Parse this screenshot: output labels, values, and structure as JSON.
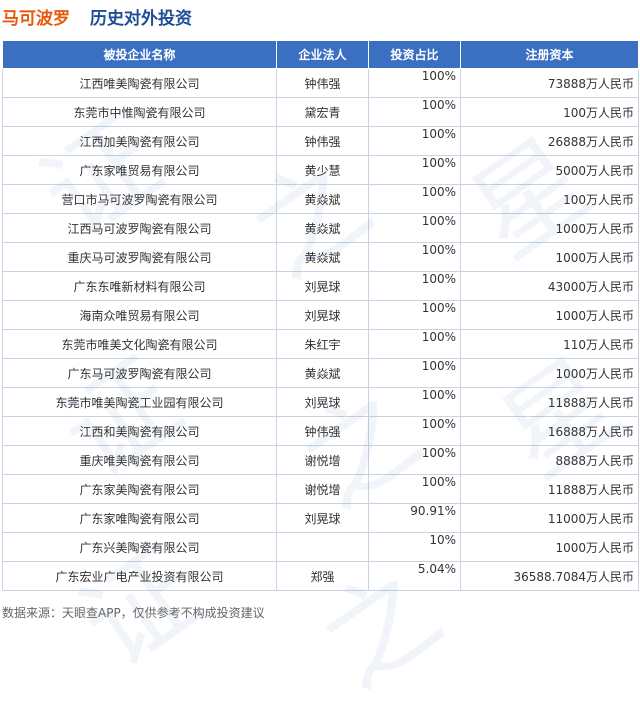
{
  "header": {
    "company": "马可波罗",
    "section": "历史对外投资"
  },
  "table": {
    "columns": [
      "被投企业名称",
      "企业法人",
      "投资占比",
      "注册资本"
    ],
    "rows": [
      {
        "name": "江西唯美陶瓷有限公司",
        "rep": "钟伟强",
        "ratio": "100%",
        "capital": "73888万人民币"
      },
      {
        "name": "东莞市中惟陶瓷有限公司",
        "rep": "黛宏青",
        "ratio": "100%",
        "capital": "100万人民币"
      },
      {
        "name": "江西加美陶瓷有限公司",
        "rep": "钟伟强",
        "ratio": "100%",
        "capital": "26888万人民币"
      },
      {
        "name": "广东家唯贸易有限公司",
        "rep": "黄少慧",
        "ratio": "100%",
        "capital": "5000万人民币"
      },
      {
        "name": "营口市马可波罗陶瓷有限公司",
        "rep": "黄焱斌",
        "ratio": "100%",
        "capital": "100万人民币"
      },
      {
        "name": "江西马可波罗陶瓷有限公司",
        "rep": "黄焱斌",
        "ratio": "100%",
        "capital": "1000万人民币"
      },
      {
        "name": "重庆马可波罗陶瓷有限公司",
        "rep": "黄焱斌",
        "ratio": "100%",
        "capital": "1000万人民币"
      },
      {
        "name": "广东东唯新材料有限公司",
        "rep": "刘晃球",
        "ratio": "100%",
        "capital": "43000万人民币"
      },
      {
        "name": "海南众唯贸易有限公司",
        "rep": "刘晃球",
        "ratio": "100%",
        "capital": "1000万人民币"
      },
      {
        "name": "东莞市唯美文化陶瓷有限公司",
        "rep": "朱红宇",
        "ratio": "100%",
        "capital": "110万人民币"
      },
      {
        "name": "广东马可波罗陶瓷有限公司",
        "rep": "黄焱斌",
        "ratio": "100%",
        "capital": "1000万人民币"
      },
      {
        "name": "东莞市唯美陶瓷工业园有限公司",
        "rep": "刘晃球",
        "ratio": "100%",
        "capital": "11888万人民币"
      },
      {
        "name": "江西和美陶瓷有限公司",
        "rep": "钟伟强",
        "ratio": "100%",
        "capital": "16888万人民币"
      },
      {
        "name": "重庆唯美陶瓷有限公司",
        "rep": "谢悦增",
        "ratio": "100%",
        "capital": "8888万人民币"
      },
      {
        "name": "广东家美陶瓷有限公司",
        "rep": "谢悦增",
        "ratio": "100%",
        "capital": "11888万人民币"
      },
      {
        "name": "广东家唯陶瓷有限公司",
        "rep": "刘晃球",
        "ratio": "90.91%",
        "capital": "11000万人民币"
      },
      {
        "name": "广东兴美陶瓷有限公司",
        "rep": "",
        "ratio": "10%",
        "capital": "1000万人民币"
      },
      {
        "name": "广东宏业广电产业投资有限公司",
        "rep": "郑强",
        "ratio": "5.04%",
        "capital": "36588.7084万人民币"
      }
    ]
  },
  "footer": {
    "source": "数据来源：天眼查APP，仅供参考不构成投资建议"
  },
  "watermark": {
    "chars": [
      "证",
      "之",
      "星"
    ]
  }
}
